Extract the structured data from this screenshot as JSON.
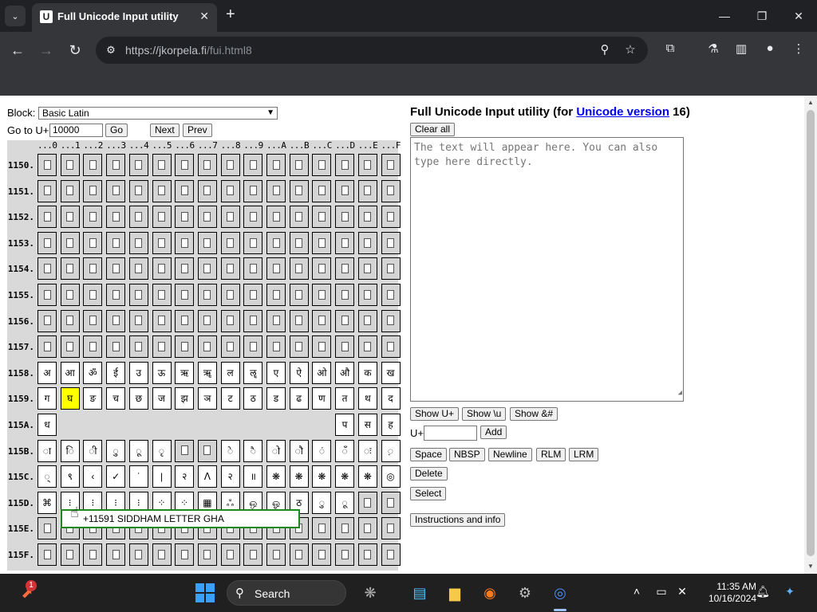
{
  "browser": {
    "tab_title": "Full Unicode Input utility",
    "favicon_text": "U",
    "url_host": "https://jkorpela.fi",
    "url_path": "/fui.html8"
  },
  "left": {
    "block_label": "Block:",
    "block_value": "Basic Latin",
    "goto_label": "Go to U+",
    "goto_value": "10000",
    "go_button": "Go",
    "next_button": "Next",
    "prev_button": "Prev",
    "col_headers": [
      "...0",
      "...1",
      "...2",
      "...3",
      "...4",
      "...5",
      "...6",
      "...7",
      "...8",
      "...9",
      "...A",
      "...B",
      "...C",
      "...D",
      "...E",
      "...F"
    ],
    "rows": [
      {
        "label": "1150.",
        "cells": [
          "",
          "",
          "",
          "",
          "",
          "",
          "",
          "",
          "",
          "",
          "",
          "",
          "",
          "",
          "",
          ""
        ]
      },
      {
        "label": "1151.",
        "cells": [
          "",
          "",
          "",
          "",
          "",
          "",
          "",
          "",
          "",
          "",
          "",
          "",
          "",
          "",
          "",
          ""
        ]
      },
      {
        "label": "1152.",
        "cells": [
          "",
          "",
          "",
          "",
          "",
          "",
          "",
          "",
          "",
          "",
          "",
          "",
          "",
          "",
          "",
          ""
        ]
      },
      {
        "label": "1153.",
        "cells": [
          "",
          "",
          "",
          "",
          "",
          "",
          "",
          "",
          "",
          "",
          "",
          "",
          "",
          "",
          "",
          ""
        ]
      },
      {
        "label": "1154.",
        "cells": [
          "",
          "",
          "",
          "",
          "",
          "",
          "",
          "",
          "",
          "",
          "",
          "",
          "",
          "",
          "",
          ""
        ]
      },
      {
        "label": "1155.",
        "cells": [
          "",
          "",
          "",
          "",
          "",
          "",
          "",
          "",
          "",
          "",
          "",
          "",
          "",
          "",
          "",
          ""
        ]
      },
      {
        "label": "1156.",
        "cells": [
          "",
          "",
          "",
          "",
          "",
          "",
          "",
          "",
          "",
          "",
          "",
          "",
          "",
          "",
          "",
          ""
        ]
      },
      {
        "label": "1157.",
        "cells": [
          "",
          "",
          "",
          "",
          "",
          "",
          "",
          "",
          "",
          "",
          "",
          "",
          "",
          "",
          "",
          ""
        ]
      },
      {
        "label": "1158.",
        "cells": [
          "अ",
          "आ",
          "ॐ",
          "ई",
          "उ",
          "ऊ",
          "ऋ",
          "ॠ",
          "ल",
          "ॡ",
          "ए",
          "ऐ",
          "ओ",
          "औ",
          "क",
          "ख"
        ]
      },
      {
        "label": "1159.",
        "cells": [
          "ग",
          "घ",
          "ङ",
          "च",
          "छ",
          "ज",
          "झ",
          "ञ",
          "ट",
          "ठ",
          "ड",
          "ढ",
          "ण",
          "त",
          "थ",
          "द"
        ]
      },
      {
        "label": "115A.",
        "cells": [
          "ध",
          "",
          "",
          "",
          "",
          "",
          "",
          "",
          "",
          "",
          "",
          "",
          "",
          "प",
          "स",
          "ह"
        ]
      },
      {
        "label": "115B.",
        "cells": [
          "ा",
          "ि",
          "ी",
          "ु",
          "ू",
          "ृ",
          "",
          "",
          "े",
          "ै",
          "ो",
          "ौ",
          "ं",
          "ँ",
          "ः",
          "़"
        ]
      },
      {
        "label": "115C.",
        "cells": [
          "्",
          "९",
          "‹",
          "✓",
          "ˈ",
          "|",
          "२",
          "ᐱ",
          "२",
          "॥",
          "❋",
          "❋",
          "❋",
          "❋",
          "❋",
          "◎"
        ]
      },
      {
        "label": "115D.",
        "cells": [
          "⌘",
          "⁝",
          "⁝",
          "⁝",
          "⁝",
          "⁘",
          "⁘",
          "▦",
          "ஃ",
          "ஒ",
          "ஓ",
          "ठ",
          "ु",
          "ू",
          "",
          ""
        ]
      },
      {
        "label": "115E.",
        "cells": [
          "",
          "",
          "",
          "",
          "",
          "",
          "",
          "",
          "",
          "",
          "",
          "",
          "",
          "",
          "",
          ""
        ]
      },
      {
        "label": "115F.",
        "cells": [
          "",
          "",
          "",
          "",
          "",
          "",
          "",
          "",
          "",
          "",
          "",
          "",
          "",
          "",
          "",
          ""
        ]
      }
    ],
    "undefined_map": {
      "115B": [
        6,
        7
      ],
      "115D": [
        14,
        15
      ]
    },
    "tooltip_text": "+11591 SIDDHAM LETTER GHA"
  },
  "right": {
    "title_prefix": "Full Unicode Input utility (for ",
    "title_link": "Unicode version",
    "title_suffix": " 16)",
    "clear_all": "Clear all",
    "textarea_placeholder": "The text will appear here. You can also type here directly.",
    "show_u": "Show U+",
    "show_backslash_u": "Show \\u",
    "show_amp": "Show &#",
    "u_label": "U+",
    "add": "Add",
    "space": "Space",
    "nbsp": "NBSP",
    "newline": "Newline",
    "rlm": "RLM",
    "lrm": "LRM",
    "delete": "Delete",
    "select": "Select",
    "instructions": "Instructions and info"
  },
  "taskbar": {
    "search": "Search",
    "time": "11:35 AM",
    "date": "10/16/2024",
    "notification_count": "1"
  },
  "colors": {
    "selected_cell": "#ffff00",
    "tooltip_border": "#1e8a1e",
    "link": "#0000ee"
  }
}
